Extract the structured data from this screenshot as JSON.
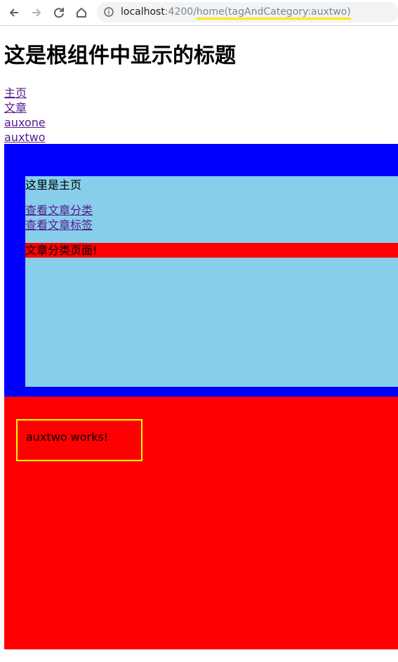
{
  "browser": {
    "back_icon": "arrow-left-icon",
    "forward_icon": "arrow-right-icon",
    "reload_icon": "reload-icon",
    "home_icon": "home-icon",
    "info_icon": "info-icon",
    "url_host": "localhost",
    "url_port": ":4200/",
    "url_path": "home(tagAndCategory:auxtwo)"
  },
  "page": {
    "title": "这是根组件中显示的标题",
    "nav_links": [
      "主页",
      "文章",
      "auxone",
      "auxtwo"
    ]
  },
  "home": {
    "text": "这里是主页",
    "links": [
      "查看文章分类",
      "查看文章标签"
    ],
    "category_text": "文章分类页面!"
  },
  "aux": {
    "text": "auxtwo works!"
  },
  "colors": {
    "blue_outlet": "#0000ff",
    "home_bg": "#87ceeb",
    "red": "#ff0000",
    "aux_border": "#ffff00",
    "url_highlight": "#ffe900"
  }
}
